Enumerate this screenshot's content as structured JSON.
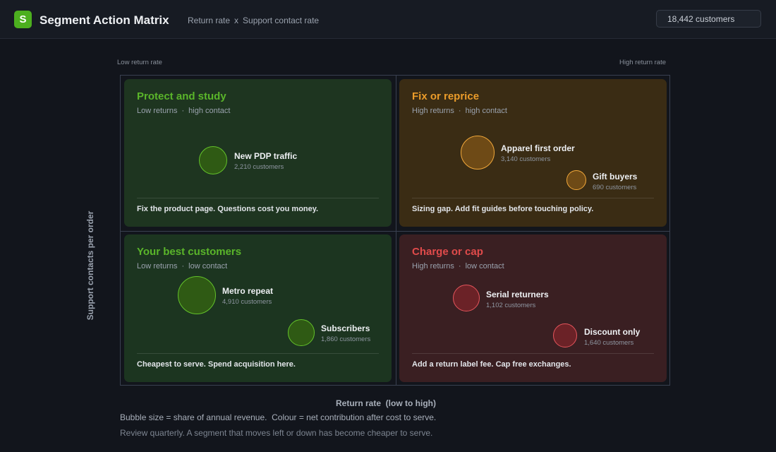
{
  "header": {
    "logo_letter": "S",
    "title": "Segment Action Matrix",
    "x_metric": "Return rate",
    "separator": "x",
    "y_metric": "Support contact rate",
    "customer_count": "18,442 customers"
  },
  "axes": {
    "top_left": "Low return rate",
    "top_right": "High return rate",
    "y_label": "Support contacts per order",
    "x_label": "Return rate  (low to high)"
  },
  "quadrants": {
    "protect": {
      "title": "Protect and study",
      "sub_a": "Low returns",
      "sub_b": "high contact",
      "note": "Fix the product page. Questions cost you money.",
      "color": "#5ab52a",
      "segments": [
        {
          "name": "New PDP traffic",
          "count": "2,210 customers"
        }
      ]
    },
    "fix": {
      "title": "Fix or reprice",
      "sub_a": "High returns",
      "sub_b": "high contact",
      "note": "Sizing gap. Add fit guides before touching policy.",
      "color": "#eb9c2a",
      "segments": [
        {
          "name": "Apparel first order",
          "count": "3,140 customers"
        },
        {
          "name": "Gift buyers",
          "count": "690 customers"
        }
      ]
    },
    "best": {
      "title": "Your best customers",
      "sub_a": "Low returns",
      "sub_b": "low contact",
      "note": "Cheapest to serve. Spend acquisition here.",
      "color": "#5ab52a",
      "segments": [
        {
          "name": "Metro repeat",
          "count": "4,910 customers"
        },
        {
          "name": "Subscribers",
          "count": "1,860 customers"
        }
      ]
    },
    "charge": {
      "title": "Charge or cap",
      "sub_a": "High returns",
      "sub_b": "low contact",
      "note": "Add a return label fee. Cap free exchanges.",
      "color": "#e14b4b",
      "segments": [
        {
          "name": "Serial returners",
          "count": "1,102 customers"
        },
        {
          "name": "Discount only",
          "count": "1,640 customers"
        }
      ]
    }
  },
  "footer": {
    "legend": "Bubble size = share of annual revenue.  Colour = net contribution after cost to serve.",
    "review": "Review quarterly. A segment that moves left or down has become cheaper to serve."
  }
}
